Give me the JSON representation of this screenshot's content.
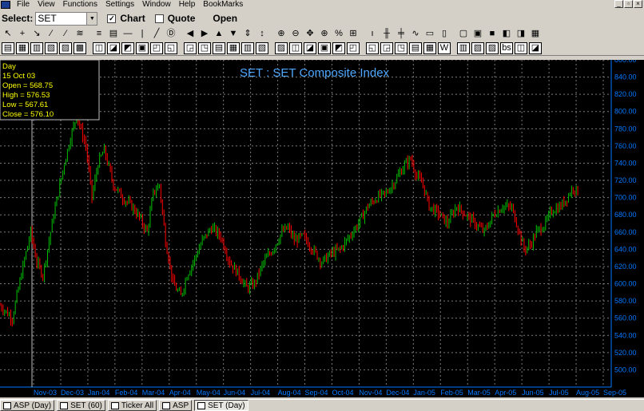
{
  "menu": {
    "items": [
      "File",
      "View",
      "Functions",
      "Settings",
      "Window",
      "Help",
      "BookMarks"
    ]
  },
  "select_bar": {
    "label": "Select:",
    "symbol": "SET",
    "chart_label": "Chart",
    "quote_label": "Quote",
    "open_label": "Open"
  },
  "toolbar1": [
    "↖",
    "+",
    "↘",
    "∕",
    "⁄",
    "≋",
    "≡",
    "▤",
    "—",
    "|",
    "╱",
    "Ⓓ",
    "◀",
    "▶",
    "▲",
    "▼",
    "⇕",
    "↕",
    "⊕",
    "⊖",
    "✥",
    "⊕",
    "%",
    "⊞",
    "ı",
    "╫",
    "╪",
    "∿",
    "▭",
    "▯",
    "▢",
    "▣",
    "■",
    "◧",
    "◨",
    "▦"
  ],
  "toolbar2": [
    "▤",
    "▦",
    "▥",
    "▧",
    "▨",
    "▩",
    "◫",
    "◪",
    "◩",
    "▣",
    "◰",
    "◱",
    "◲",
    "◳",
    "▤",
    "▦",
    "▥",
    "▧",
    "▨",
    "◫",
    "◪",
    "▣",
    "◩",
    "◰",
    "◱",
    "◲",
    "◳",
    "▤",
    "▦",
    "W",
    "▥",
    "▧",
    "▨",
    "bs",
    "◫",
    "◪"
  ],
  "info_box": {
    "period": "Day",
    "date": "15 Oct 03",
    "open": "Open = 568.75",
    "high": "High = 576.53",
    "low": "Low = 567.61",
    "close": "Close = 576.10"
  },
  "colors": {
    "up": "#00c000",
    "down": "#ff0000",
    "axis": "#0078ff",
    "title": "#4fa8ff",
    "grid": "#7a7a7a"
  },
  "taskbar": [
    {
      "label": "ASP (Day)",
      "active": false
    },
    {
      "label": "SET (60)",
      "active": false
    },
    {
      "label": "Ticker All",
      "active": false
    },
    {
      "label": "ASP",
      "active": false
    },
    {
      "label": "SET (Day)",
      "active": true
    }
  ],
  "chart_data": {
    "type": "candlestick",
    "title": "SET : SET Composite Index",
    "ylim": [
      480,
      860
    ],
    "yticks": [
      500,
      520,
      540,
      560,
      580,
      600,
      620,
      640,
      660,
      680,
      700,
      720,
      740,
      760,
      780,
      800,
      820,
      840,
      860
    ],
    "months": [
      "Nov-03",
      "Dec-03",
      "Jan-04",
      "Feb-04",
      "Mar-04",
      "Apr-04",
      "May-04",
      "Jun-04",
      "Jul-04",
      "Aug-04",
      "Sep-04",
      "Oct-04",
      "Nov-04",
      "Dec-04",
      "Jan-05",
      "Feb-05",
      "Mar-05",
      "Apr-05",
      "Jun-05",
      "Jul-05",
      "Aug-05",
      "Sep-05"
    ],
    "path_points": [
      [
        0,
        575
      ],
      [
        8,
        560
      ],
      [
        15,
        620
      ],
      [
        20,
        660
      ],
      [
        24,
        625
      ],
      [
        28,
        610
      ],
      [
        35,
        680
      ],
      [
        42,
        740
      ],
      [
        46,
        770
      ],
      [
        50,
        795
      ],
      [
        56,
        760
      ],
      [
        60,
        700
      ],
      [
        64,
        740
      ],
      [
        68,
        755
      ],
      [
        74,
        715
      ],
      [
        80,
        700
      ],
      [
        86,
        690
      ],
      [
        90,
        680
      ],
      [
        96,
        660
      ],
      [
        100,
        705
      ],
      [
        104,
        715
      ],
      [
        108,
        650
      ],
      [
        113,
        600
      ],
      [
        118,
        585
      ],
      [
        122,
        610
      ],
      [
        126,
        625
      ],
      [
        132,
        650
      ],
      [
        138,
        665
      ],
      [
        144,
        655
      ],
      [
        150,
        625
      ],
      [
        156,
        610
      ],
      [
        161,
        595
      ],
      [
        166,
        600
      ],
      [
        172,
        625
      ],
      [
        178,
        640
      ],
      [
        184,
        660
      ],
      [
        188,
        665
      ],
      [
        192,
        650
      ],
      [
        198,
        655
      ],
      [
        204,
        640
      ],
      [
        210,
        625
      ],
      [
        216,
        635
      ],
      [
        222,
        640
      ],
      [
        228,
        655
      ],
      [
        234,
        670
      ],
      [
        240,
        690
      ],
      [
        246,
        700
      ],
      [
        252,
        705
      ],
      [
        258,
        720
      ],
      [
        264,
        738
      ],
      [
        268,
        745
      ],
      [
        272,
        725
      ],
      [
        276,
        715
      ],
      [
        280,
        690
      ],
      [
        286,
        682
      ],
      [
        292,
        670
      ],
      [
        298,
        690
      ],
      [
        304,
        680
      ],
      [
        310,
        670
      ],
      [
        316,
        660
      ],
      [
        322,
        680
      ],
      [
        328,
        690
      ],
      [
        334,
        688
      ],
      [
        338,
        665
      ],
      [
        342,
        640
      ],
      [
        346,
        645
      ],
      [
        350,
        660
      ],
      [
        356,
        670
      ],
      [
        360,
        685
      ],
      [
        366,
        690
      ],
      [
        370,
        700
      ],
      [
        374,
        712
      ],
      [
        378,
        705
      ]
    ],
    "candle_count": 378
  }
}
